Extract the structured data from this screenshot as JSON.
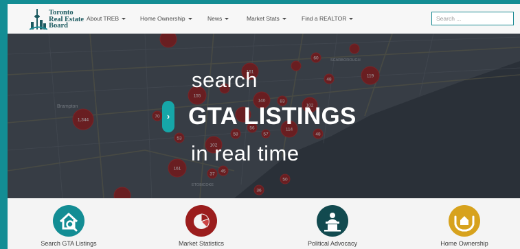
{
  "brand": {
    "line1": "Toronto",
    "line2": "Real Estate",
    "line3": "Board"
  },
  "nav": [
    {
      "label": "About TREB"
    },
    {
      "label": "Home Ownership"
    },
    {
      "label": "News"
    },
    {
      "label": "Market Stats"
    },
    {
      "label": "Find a REALTOR"
    }
  ],
  "search": {
    "placeholder": "Search ..."
  },
  "hero": {
    "line1": "search",
    "line2": "GTA LISTINGS",
    "line3": "in real time",
    "expand_glyph": "›"
  },
  "map": {
    "place_labels": [
      "Brampton",
      "SCARBOROUGH",
      "ETOBICOKE"
    ],
    "clusters": [
      "1,344",
      "161",
      "119",
      "155",
      "140",
      "102",
      "114",
      "102",
      "161",
      "83",
      "60",
      "48",
      "58",
      "56",
      "57",
      "37",
      "45",
      "48",
      "50",
      "53",
      "70",
      "36"
    ]
  },
  "features": [
    {
      "label": "Search GTA Listings",
      "color": "#138d94",
      "icon": "house-search-icon"
    },
    {
      "label": "Market Statistics",
      "color": "#9b1d1d",
      "icon": "pie-chart-icon"
    },
    {
      "label": "Political Advocacy",
      "color": "#124a4f",
      "icon": "podium-icon"
    },
    {
      "label": "Home Ownership",
      "color": "#d7a21d",
      "icon": "hands-house-icon"
    }
  ]
}
